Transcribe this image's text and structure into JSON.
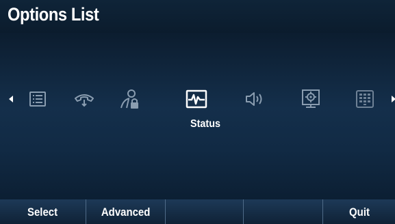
{
  "title": "Options List",
  "icons": [
    {
      "name": "directory-icon",
      "label": ""
    },
    {
      "name": "call-forward-icon",
      "label": ""
    },
    {
      "name": "user-lock-icon",
      "label": ""
    },
    {
      "name": "status-icon",
      "label": "Status",
      "selected": true
    },
    {
      "name": "volume-icon",
      "label": ""
    },
    {
      "name": "network-settings-icon",
      "label": ""
    },
    {
      "name": "keypad-icon",
      "label": ""
    }
  ],
  "selected_label": "Status",
  "softkeys": {
    "key1": "Select",
    "key2": "Advanced",
    "key3": "",
    "key4": "",
    "key5": "Quit"
  },
  "colors": {
    "icon_inactive": "#8a9db0",
    "icon_active": "#ffffff",
    "background": "#132c46"
  }
}
